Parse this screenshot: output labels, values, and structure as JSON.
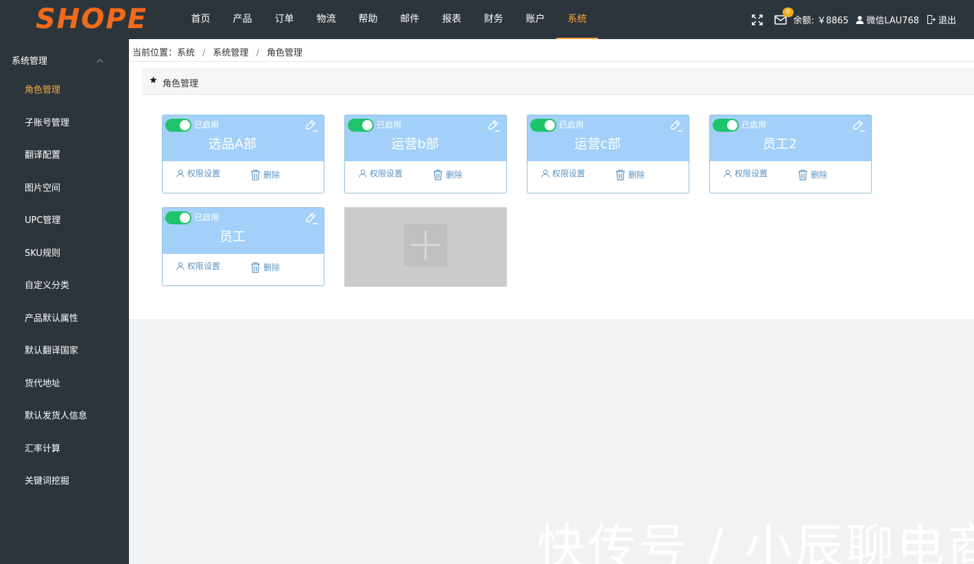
{
  "header": {
    "logo": "SHOPE",
    "nav": [
      "首页",
      "产品",
      "订单",
      "物流",
      "帮助",
      "邮件",
      "报表",
      "财务",
      "账户",
      "系统"
    ],
    "active_nav": "系统",
    "mail_badge": "0",
    "balance": "余额: ￥8865",
    "user": "微信LAU768",
    "logout": "退出",
    "icons": [
      "fullscreen-icon",
      "mail-icon",
      "user-icon",
      "logout-icon"
    ]
  },
  "sidebar": {
    "section": "系统管理",
    "items": [
      "角色管理",
      "子账号管理",
      "翻译配置",
      "图片空间",
      "UPC管理",
      "SKU规则",
      "自定义分类",
      "产品默认属性",
      "默认翻译国家",
      "货代地址",
      "默认发货人信息",
      "汇率计算",
      "关键词挖掘"
    ],
    "active_item": "角色管理"
  },
  "breadcrumb": {
    "prefix": "当前位置：",
    "parts": [
      "系统",
      "系统管理",
      "角色管理"
    ]
  },
  "panel": {
    "title": "角色管理"
  },
  "roles": [
    {
      "name": "选品A部",
      "status": "已启用",
      "enabled": true
    },
    {
      "name": "运营b部",
      "status": "已启用",
      "enabled": true
    },
    {
      "name": "运营c部",
      "status": "已启用",
      "enabled": true
    },
    {
      "name": "员工2",
      "status": "已启用",
      "enabled": true
    },
    {
      "name": "员工",
      "status": "已启用",
      "enabled": true
    }
  ],
  "card_actions": {
    "permission": "权限设置",
    "delete": "删除"
  },
  "watermark": "快传号 / 小辰聊电商",
  "colors": {
    "accent": "#f7a63b",
    "logo": "#f26a1b",
    "card_header": "#a3d0f8",
    "toggle_on": "#1ec46b",
    "dark_bg": "#2d353c"
  }
}
